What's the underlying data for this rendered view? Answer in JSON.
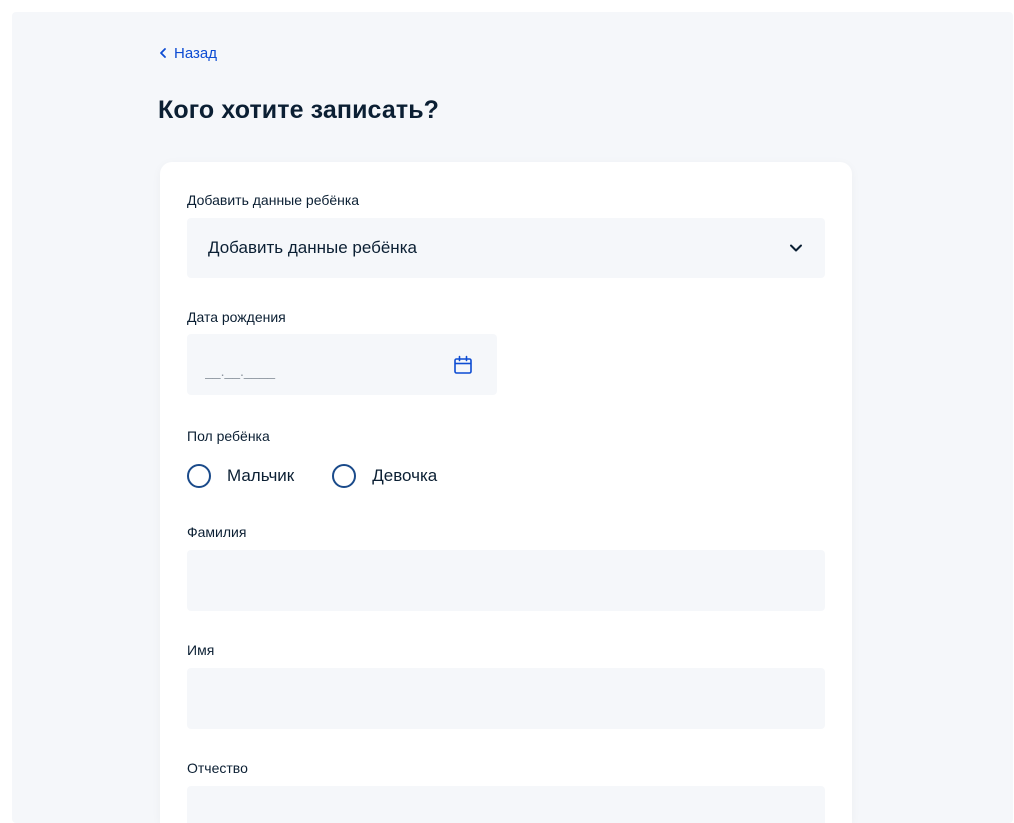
{
  "nav": {
    "back_label": "Назад"
  },
  "page": {
    "title": "Кого хотите записать?"
  },
  "form": {
    "child_select": {
      "label": "Добавить данные ребёнка",
      "value": "Добавить данные ребёнка",
      "icon": "chevron-down-icon"
    },
    "birth_date": {
      "label": "Дата рождения",
      "placeholder": "__.__.____",
      "value": "",
      "icon": "calendar-icon"
    },
    "gender": {
      "label": "Пол ребёнка",
      "options": [
        {
          "label": "Мальчик",
          "selected": false
        },
        {
          "label": "Девочка",
          "selected": false
        }
      ]
    },
    "last_name": {
      "label": "Фамилия",
      "value": ""
    },
    "first_name": {
      "label": "Имя",
      "value": ""
    },
    "patronymic": {
      "label": "Отчество",
      "value": ""
    }
  },
  "colors": {
    "accent": "#0d4cd3",
    "text": "#0b1f33",
    "field_bg": "#f5f7fa",
    "radio_border": "#1a4a8a"
  }
}
